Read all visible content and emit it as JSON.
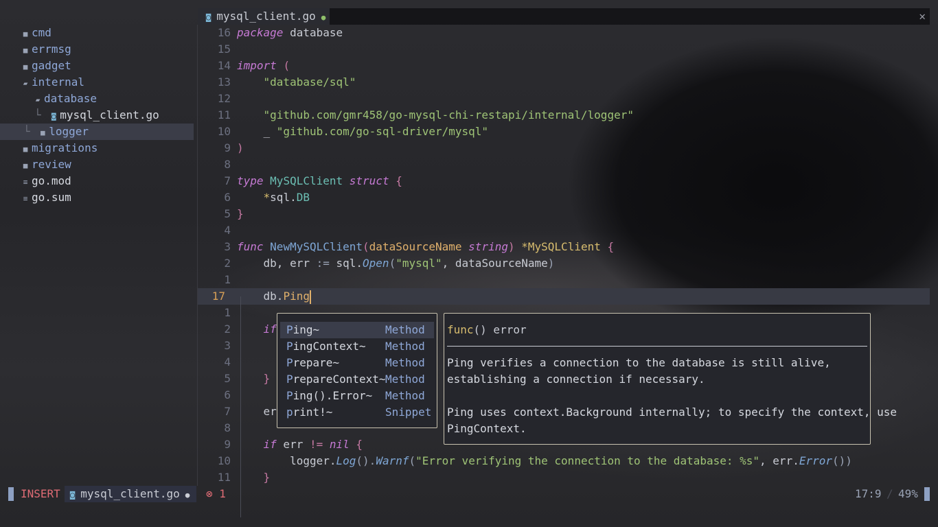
{
  "sidebar": {
    "items": [
      {
        "label": "cmd",
        "kind": "folder",
        "icon": "folder-icon"
      },
      {
        "label": "errmsg",
        "kind": "folder",
        "icon": "folder-icon"
      },
      {
        "label": "gadget",
        "kind": "folder",
        "icon": "folder-icon"
      },
      {
        "label": "internal",
        "kind": "folder-open",
        "icon": "folder-open-icon"
      },
      {
        "label": "database",
        "kind": "folder-open",
        "icon": "folder-open-icon"
      },
      {
        "label": "mysql_client.go",
        "kind": "go-file",
        "icon": "go-file-icon"
      },
      {
        "label": "logger",
        "kind": "folder",
        "icon": "folder-icon",
        "selected": true
      },
      {
        "label": "migrations",
        "kind": "folder",
        "icon": "folder-icon"
      },
      {
        "label": "review",
        "kind": "folder",
        "icon": "folder-icon"
      },
      {
        "label": "go.mod",
        "kind": "file",
        "icon": "file-icon"
      },
      {
        "label": "go.sum",
        "kind": "file",
        "icon": "file-icon"
      }
    ]
  },
  "tabbar": {
    "active_tab": "mysql_client.go",
    "close_glyph": "✕"
  },
  "editor": {
    "lines": [
      {
        "num": "16",
        "tokens": [
          [
            "kw",
            "package"
          ],
          [
            "txt",
            " database"
          ]
        ]
      },
      {
        "num": "15",
        "tokens": []
      },
      {
        "num": "14",
        "tokens": [
          [
            "kw",
            "import"
          ],
          [
            "txt",
            " "
          ],
          [
            "punc",
            "("
          ]
        ]
      },
      {
        "num": "13",
        "tokens": [
          [
            "txt",
            "    "
          ],
          [
            "str",
            "\"database/sql\""
          ]
        ]
      },
      {
        "num": "12",
        "tokens": []
      },
      {
        "num": "11",
        "tokens": [
          [
            "txt",
            "    "
          ],
          [
            "str",
            "\"github.com/gmr458/go-mysql-chi-restapi/internal/logger\""
          ]
        ]
      },
      {
        "num": "10",
        "tokens": [
          [
            "txt",
            "    _ "
          ],
          [
            "str",
            "\"github.com/go-sql-driver/mysql\""
          ]
        ]
      },
      {
        "num": "9",
        "tokens": [
          [
            "punc",
            ")"
          ]
        ]
      },
      {
        "num": "8",
        "tokens": []
      },
      {
        "num": "7",
        "tokens": [
          [
            "kw",
            "type"
          ],
          [
            "txt",
            " "
          ],
          [
            "ty2",
            "MySQLClient"
          ],
          [
            "txt",
            " "
          ],
          [
            "kw",
            "struct"
          ],
          [
            "txt",
            " "
          ],
          [
            "punc",
            "{"
          ]
        ]
      },
      {
        "num": "6",
        "tokens": [
          [
            "txt",
            "    "
          ],
          [
            "ty",
            "*"
          ],
          [
            "txt",
            "sql."
          ],
          [
            "field",
            "DB"
          ]
        ]
      },
      {
        "num": "5",
        "tokens": [
          [
            "punc",
            "}"
          ]
        ]
      },
      {
        "num": "4",
        "tokens": []
      },
      {
        "num": "3",
        "tokens": [
          [
            "kw",
            "func"
          ],
          [
            "txt",
            " "
          ],
          [
            "fn",
            "NewMySQLClient"
          ],
          [
            "punc",
            "("
          ],
          [
            "param",
            "dataSourceName"
          ],
          [
            "txt",
            " "
          ],
          [
            "kw",
            "string"
          ],
          [
            "punc",
            ")"
          ],
          [
            "txt",
            " "
          ],
          [
            "ty",
            "*"
          ],
          [
            "ty",
            "MySQLClient"
          ],
          [
            "txt",
            " "
          ],
          [
            "punc",
            "{"
          ]
        ]
      },
      {
        "num": "2",
        "tokens": [
          [
            "txt",
            "    db, err "
          ],
          [
            "op",
            ":="
          ],
          [
            "txt",
            " sql."
          ],
          [
            "method",
            "Open"
          ],
          [
            "op",
            "("
          ],
          [
            "str",
            "\"mysql\""
          ],
          [
            "txt",
            ", dataSourceName"
          ],
          [
            "op",
            ")"
          ]
        ]
      },
      {
        "num": "1",
        "tokens": []
      },
      {
        "num": "17",
        "current": true,
        "tokens": [
          [
            "txt",
            "    db."
          ],
          [
            "ping",
            "Ping"
          ]
        ]
      },
      {
        "num": "1",
        "tokens": []
      },
      {
        "num": "2",
        "tokens": [
          [
            "txt",
            "    "
          ],
          [
            "kw",
            "if"
          ]
        ]
      },
      {
        "num": "3",
        "tokens": []
      },
      {
        "num": "4",
        "tokens": []
      },
      {
        "num": "5",
        "tokens": [
          [
            "txt",
            "    "
          ],
          [
            "punc",
            "}"
          ]
        ]
      },
      {
        "num": "6",
        "tokens": []
      },
      {
        "num": "7",
        "tokens": [
          [
            "txt",
            "    er"
          ]
        ]
      },
      {
        "num": "8",
        "tokens": []
      },
      {
        "num": "9",
        "tokens": [
          [
            "txt",
            "    "
          ],
          [
            "kw",
            "if"
          ],
          [
            "txt",
            " err "
          ],
          [
            "punc",
            "!="
          ],
          [
            "txt",
            " "
          ],
          [
            "kw",
            "nil"
          ],
          [
            "txt",
            " "
          ],
          [
            "punc",
            "{"
          ]
        ]
      },
      {
        "num": "10",
        "tokens": [
          [
            "txt",
            "        logger."
          ],
          [
            "method",
            "Log"
          ],
          [
            "op",
            "()."
          ],
          [
            "method",
            "Warnf"
          ],
          [
            "op",
            "("
          ],
          [
            "str",
            "\"Error verifying the connection to the database: %s\""
          ],
          [
            "txt",
            ", err."
          ],
          [
            "method",
            "Error"
          ],
          [
            "op",
            "())"
          ]
        ]
      },
      {
        "num": "11",
        "tokens": [
          [
            "txt",
            "    "
          ],
          [
            "punc",
            "}"
          ]
        ]
      }
    ]
  },
  "completion": {
    "items": [
      {
        "match": "P",
        "rest": "ing~",
        "kind": "Method",
        "selected": true
      },
      {
        "match": "P",
        "rest": "ingContext~",
        "kind": "Method"
      },
      {
        "match": "P",
        "rest": "repare~",
        "kind": "Method"
      },
      {
        "match": "P",
        "rest": "repareContext~",
        "kind": "Method"
      },
      {
        "match": "P",
        "rest": "ing().Error~",
        "kind": "Method"
      },
      {
        "match": "p",
        "rest": "rint!~",
        "kind": "Snippet"
      }
    ]
  },
  "docs": {
    "sig_func": "func",
    "sig_rest": "() error",
    "para1_l1": "Ping verifies a connection to the database is still alive,",
    "para1_l2": "establishing a connection if necessary.",
    "para2_l1": "Ping uses context.Background internally; to specify the context, use",
    "para2_l2": "PingContext."
  },
  "statusbar": {
    "mode": "INSERT",
    "file": "mysql_client.go",
    "errors": "⊗ 1",
    "position": "17:9",
    "percent": "49%"
  },
  "colors": {
    "accent": "#8da0c2",
    "mode_insert": "#e06c75",
    "keyword": "#c67ad4",
    "string": "#9fc476",
    "function": "#7fa7d6"
  }
}
